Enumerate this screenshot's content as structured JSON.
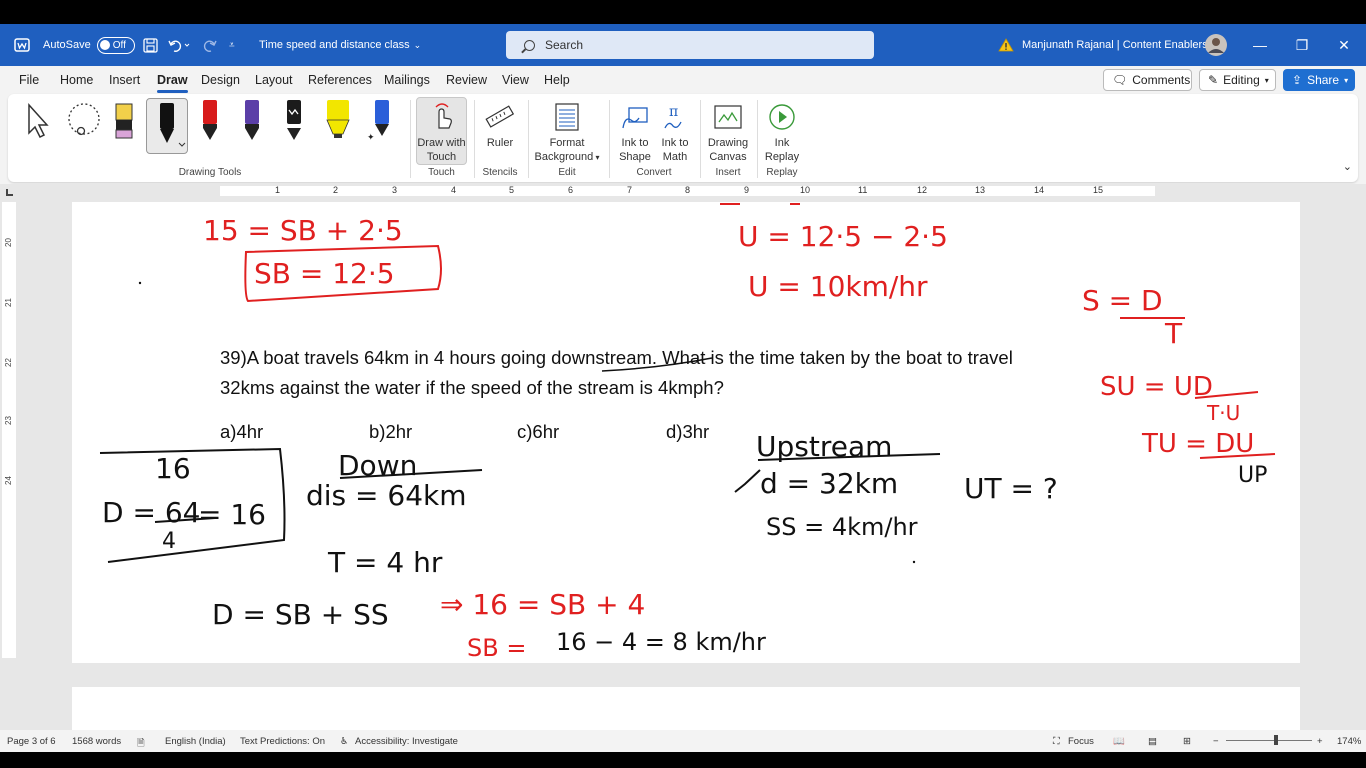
{
  "titlebar": {
    "autosave_label": "AutoSave",
    "autosave_state": "Off",
    "doc_title": "Time speed and distance class",
    "search_placeholder": "Search",
    "user_name": "Manjunath Rajanal | Content Enablers"
  },
  "tabs": [
    "File",
    "Home",
    "Insert",
    "Draw",
    "Design",
    "Layout",
    "References",
    "Mailings",
    "Review",
    "View",
    "Help"
  ],
  "active_tab": "Draw",
  "actions": {
    "comments": "Comments",
    "editing": "Editing",
    "share": "Share"
  },
  "ribbon": {
    "groups": {
      "drawing_tools": "Drawing Tools",
      "touch": "Touch",
      "stencils": "Stencils",
      "edit": "Edit",
      "convert": "Convert",
      "insert": "Insert",
      "replay": "Replay"
    },
    "buttons": {
      "draw_with_touch_1": "Draw with",
      "draw_with_touch_2": "Touch",
      "ruler": "Ruler",
      "format_background_1": "Format",
      "format_background_2": "Background",
      "ink_to_shape_1": "Ink to",
      "ink_to_shape_2": "Shape",
      "ink_to_math_1": "Ink to",
      "ink_to_math_2": "Math",
      "drawing_canvas_1": "Drawing",
      "drawing_canvas_2": "Canvas",
      "ink_replay_1": "Ink",
      "ink_replay_2": "Replay"
    },
    "pen_colors": [
      "#d81b1b",
      "#5b3fa8",
      "#1b1b1b",
      "#f2e600",
      "#2b5fd9"
    ]
  },
  "ruler_numbers": [
    "1",
    "2",
    "3",
    "4",
    "5",
    "6",
    "7",
    "8",
    "9",
    "10",
    "11",
    "12",
    "13",
    "14",
    "15"
  ],
  "vruler_numbers": [
    "20",
    "21",
    "22",
    "23",
    "24"
  ],
  "document": {
    "question_line1": "39)A boat travels 64km in 4 hours going downstream. What is the time taken by the boat to travel",
    "question_line2": "32kms against the water if the speed of the stream is 4kmph?",
    "options": [
      "a)4hr",
      "b)2hr",
      "c)6hr",
      "d)3hr"
    ]
  },
  "ink": {
    "top_left_1": "15 = SB + 2·5",
    "top_left_2": "SB = 12·5",
    "top_mid_1": "U = 12·5 − 2·5",
    "top_mid_2": "U = 10km/hr",
    "right_1": "S = D",
    "right_1b": "T",
    "right_2": "SU = UD",
    "right_2b": "T·U",
    "right_3": "TU = DU",
    "right_3b": "UP",
    "box_1": "16",
    "box_2": "D = 64",
    "box_3": "4",
    "box_4": "= 16",
    "down_title": "Down",
    "down_dis": "dis = 64km",
    "down_t": "T = 4 hr",
    "formula": "D = SB + SS",
    "formula_red": "⇒ 16 = SB + 4",
    "sb_line_red": "SB =",
    "sb_line": "16 − 4 = 8 km/hr",
    "up_title": "Upstream",
    "up_d": "d = 32km",
    "up_ss": "SS = 4km/hr",
    "up_ut": "UT = ?"
  },
  "statusbar": {
    "page": "Page 3 of 6",
    "words": "1568 words",
    "language": "English (India)",
    "text_predictions": "Text Predictions: On",
    "accessibility": "Accessibility: Investigate",
    "focus": "Focus",
    "zoom": "174%"
  },
  "colors": {
    "accent": "#1f5fbf",
    "ink_red": "#e02020",
    "ink_black": "#111111"
  }
}
